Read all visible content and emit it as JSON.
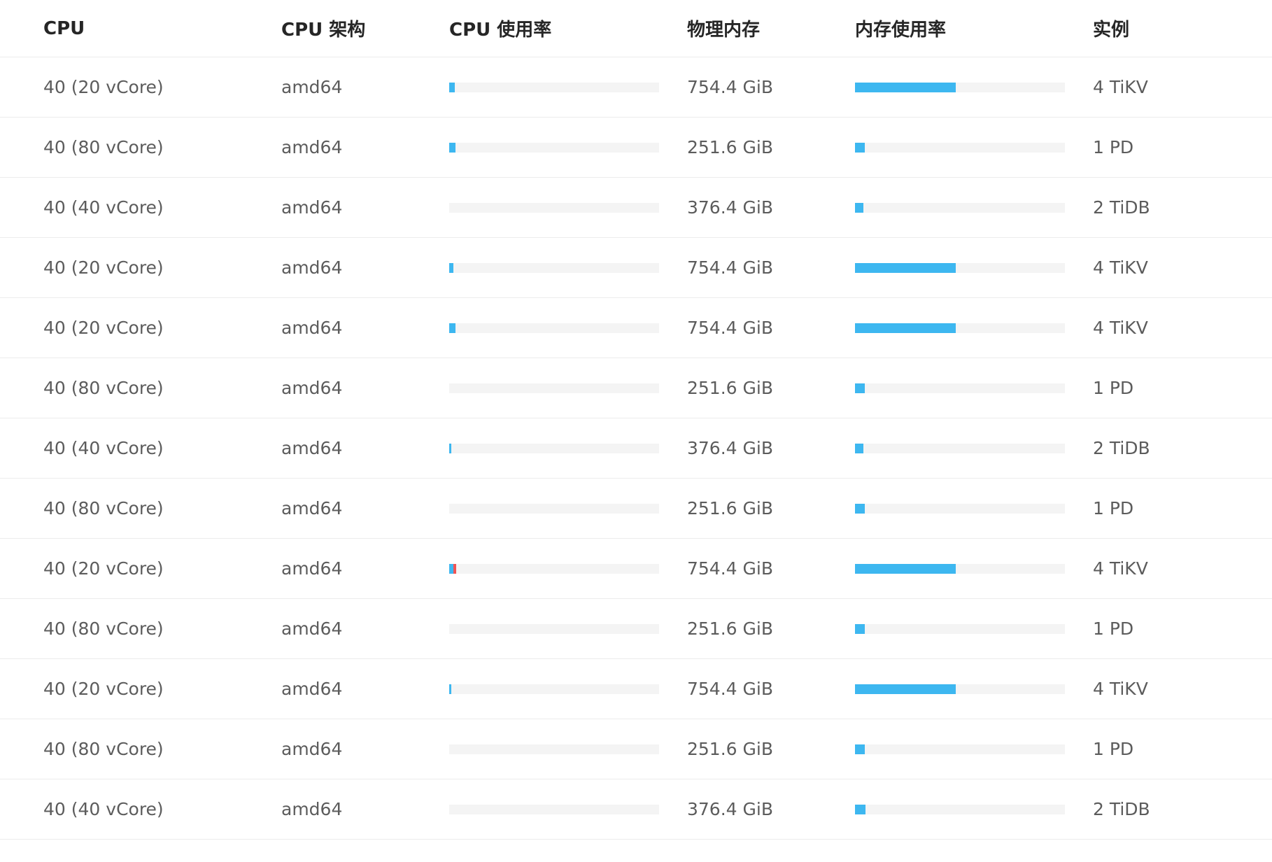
{
  "colors": {
    "bar_fill": "#3db7f0",
    "bar_track": "#f4f4f4",
    "bar_alert": "#f05454"
  },
  "table": {
    "headers": [
      "CPU",
      "CPU 架构",
      "CPU 使用率",
      "物理内存",
      "内存使用率",
      "实例"
    ],
    "rows": [
      {
        "cpu": "40 (20 vCore)",
        "arch": "amd64",
        "cpu_usage": 0.025,
        "cpu_alert": 0,
        "memory": "754.4 GiB",
        "memory_usage": 0.48,
        "instance": "4 TiKV"
      },
      {
        "cpu": "40 (80 vCore)",
        "arch": "amd64",
        "cpu_usage": 0.03,
        "cpu_alert": 0,
        "memory": "251.6 GiB",
        "memory_usage": 0.045,
        "instance": "1 PD"
      },
      {
        "cpu": "40 (40 vCore)",
        "arch": "amd64",
        "cpu_usage": 0,
        "cpu_alert": 0,
        "memory": "376.4 GiB",
        "memory_usage": 0.04,
        "instance": "2 TiDB"
      },
      {
        "cpu": "40 (20 vCore)",
        "arch": "amd64",
        "cpu_usage": 0.02,
        "cpu_alert": 0,
        "memory": "754.4 GiB",
        "memory_usage": 0.48,
        "instance": "4 TiKV"
      },
      {
        "cpu": "40 (20 vCore)",
        "arch": "amd64",
        "cpu_usage": 0.03,
        "cpu_alert": 0,
        "memory": "754.4 GiB",
        "memory_usage": 0.48,
        "instance": "4 TiKV"
      },
      {
        "cpu": "40 (80 vCore)",
        "arch": "amd64",
        "cpu_usage": 0,
        "cpu_alert": 0,
        "memory": "251.6 GiB",
        "memory_usage": 0.045,
        "instance": "1 PD"
      },
      {
        "cpu": "40 (40 vCore)",
        "arch": "amd64",
        "cpu_usage": 0.01,
        "cpu_alert": 0,
        "memory": "376.4 GiB",
        "memory_usage": 0.04,
        "instance": "2 TiDB"
      },
      {
        "cpu": "40 (80 vCore)",
        "arch": "amd64",
        "cpu_usage": 0,
        "cpu_alert": 0,
        "memory": "251.6 GiB",
        "memory_usage": 0.045,
        "instance": "1 PD"
      },
      {
        "cpu": "40 (20 vCore)",
        "arch": "amd64",
        "cpu_usage": 0.02,
        "cpu_alert": 0.012,
        "memory": "754.4 GiB",
        "memory_usage": 0.48,
        "instance": "4 TiKV"
      },
      {
        "cpu": "40 (80 vCore)",
        "arch": "amd64",
        "cpu_usage": 0,
        "cpu_alert": 0,
        "memory": "251.6 GiB",
        "memory_usage": 0.045,
        "instance": "1 PD"
      },
      {
        "cpu": "40 (20 vCore)",
        "arch": "amd64",
        "cpu_usage": 0.01,
        "cpu_alert": 0,
        "memory": "754.4 GiB",
        "memory_usage": 0.48,
        "instance": "4 TiKV"
      },
      {
        "cpu": "40 (80 vCore)",
        "arch": "amd64",
        "cpu_usage": 0,
        "cpu_alert": 0,
        "memory": "251.6 GiB",
        "memory_usage": 0.045,
        "instance": "1 PD"
      },
      {
        "cpu": "40 (40 vCore)",
        "arch": "amd64",
        "cpu_usage": 0,
        "cpu_alert": 0,
        "memory": "376.4 GiB",
        "memory_usage": 0.05,
        "instance": "2 TiDB"
      }
    ]
  }
}
